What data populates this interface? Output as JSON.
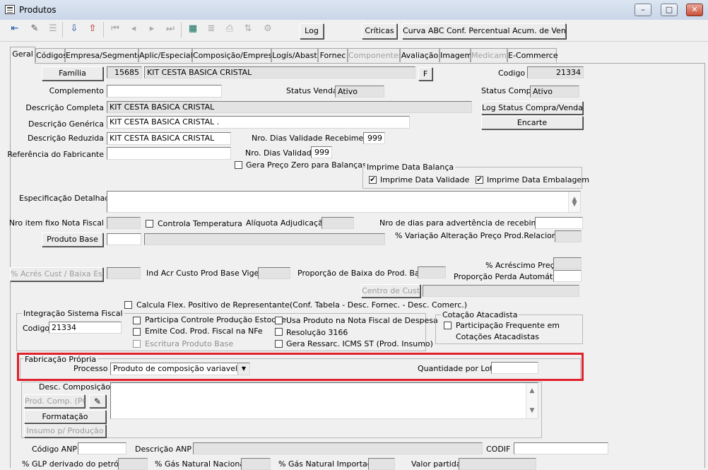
{
  "window": {
    "title": "Produtos"
  },
  "toolbar": {
    "log": "Log",
    "criticas": "Críticas",
    "curva": "Curva ABC Conf. Percentual Acum. de Venda"
  },
  "tabs": [
    "Geral",
    "Códigos",
    "Empresa/Segmento",
    "Aplic/Especial",
    "Composição/Empresa",
    "Logís/Abast",
    "Fornec",
    "Componentes",
    "Avaliação",
    "Imagem",
    "Medicam.",
    "E-Commerce"
  ],
  "geral": {
    "familia_button": "Família",
    "familia_code": "15685",
    "familia_name": "KIT CESTA BASICA CRISTAL",
    "f_button": "F",
    "codigo_label": "Codigo",
    "codigo_value": "21334",
    "complemento_label": "Complemento",
    "status_venda_label": "Status Venda",
    "status_venda_value": "Ativo",
    "status_compra_label": "Status Compra",
    "status_compra_value": "Ativo",
    "descricao_completa_label": "Descrição Completa",
    "descricao_completa_value": "KIT CESTA BASICA CRISTAL",
    "log_status_button": "Log Status Compra/Venda",
    "descricao_generica_label": "Descrição Genérica",
    "descricao_generica_value": "KIT CESTA BASICA CRISTAL .",
    "encarte_button": "Encarte",
    "descricao_reduzida_label": "Descrição Reduzida",
    "descricao_reduzida_value": "KIT CESTA BASICA CRISTAL",
    "nro_dias_receb_label": "Nro. Dias Validade Recebimento",
    "nro_dias_receb_value": "999",
    "referencia_label": "Referência do Fabricante",
    "nro_dias_validade_label": "Nro. Dias Validade",
    "nro_dias_validade_value": "999",
    "gera_preco_zero": "Gera Preço Zero para Balanças",
    "imprime_group": "Imprime Data Balança",
    "imprime_validade": "Imprime Data Validade",
    "imprime_embalagem": "Imprime Data Embalagem",
    "especificacao_label": "Especificação Detalhada",
    "nro_item_label": "Nro item fixo Nota Fiscal",
    "controla_temp": "Controla Temperatura",
    "aliquota_label": "Alíquota Adjudicação",
    "nro_dias_adv_label": "Nro de dias para advertência de recebimento",
    "produto_base_button": "Produto Base",
    "variacao_label": "% Variação Alteração Preço Prod.Relacionado",
    "acrescimo_preco_label": "% Acréscimo Preço",
    "acres_cust_button": "% Acrés Cust / Baixa Estq",
    "ind_acr_label": "Ind Acr Custo Prod Base Vigente",
    "proporcao_baixa_label": "Proporção de Baixa do Prod. Base",
    "proporcao_perda_label": "Proporção Perda Automática",
    "centro_custo_button": "Centro de Custo",
    "calcula_flex": "Calcula Flex. Positivo de Representante(Conf. Tabela - Desc. Fornec. - Desc. Comerc.)",
    "fiscal_group": "Integração Sistema Fiscal",
    "fiscal_codigo_label": "Codigo",
    "fiscal_codigo_value": "21334",
    "participa_controle": "Participa Controle Produção Estoque",
    "emite_cod": "Emite Cod. Prod. Fiscal na NFe",
    "escritura": "Escritura Produto Base",
    "usa_produto": "Usa Produto na Nota Fiscal de Despesa",
    "resolucao": "Resolução 3166",
    "gera_ressarc": "Gera Ressarc. ICMS ST (Prod. Insumo)",
    "cotacao_group": "Cotação Atacadista",
    "participacao_freq_1": "Participação Frequente em",
    "participacao_freq_2": "Cotações Atacadistas",
    "fabricacao_group": "Fabricação Própria",
    "processo_label": "Processo",
    "processo_value": "Produto de composição variavel",
    "quantidade_lote_label": "Quantidade por Lote",
    "desc_composicao_label": "Desc. Composição",
    "prod_comp_button": "Prod. Comp. (PC)",
    "formatacao_button": "Formatação",
    "insumo_button": "Insumo p/ Produção",
    "codigo_anp_label": "Código ANP",
    "descricao_anp_label": "Descrição ANP",
    "codif_label": "CODIF",
    "glp_label": "% GLP derivado do petróleo",
    "gas_nacional_label": "% Gás Natural Nacional",
    "gas_importado_label": "% Gás Natural Importado",
    "valor_partida_label": "Valor partida"
  },
  "colors": {
    "highlight": "#e0202a",
    "titlebar": "#c9d6e8"
  }
}
